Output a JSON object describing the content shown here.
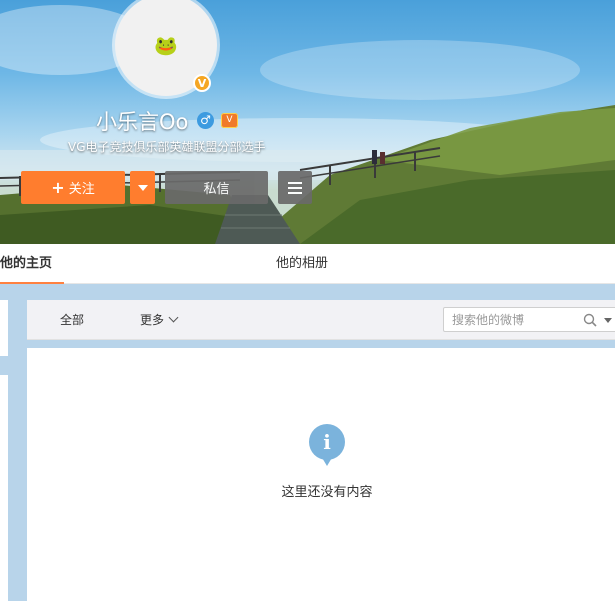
{
  "profile": {
    "avatar_emoji": "🐸",
    "verified_glyph": "V",
    "name": "小乐言Oo",
    "gender_glyph": "♂",
    "member_glyph": "V",
    "bio": "VG电子竞技俱乐部英雄联盟分部选手"
  },
  "actions": {
    "follow_plus": "+",
    "follow_label": "关注",
    "message_label": "私信"
  },
  "tabs": [
    {
      "label": "他的主页",
      "active": true
    },
    {
      "label": "他的相册",
      "active": false
    }
  ],
  "feed": {
    "filters": {
      "all": "全部",
      "more": "更多"
    },
    "search_placeholder": "搜索他的微博",
    "empty_icon": "i",
    "empty_message": "这里还没有内容"
  },
  "colors": {
    "accent": "#ff7d2e",
    "tab_underline": "#ff8140",
    "info_icon": "#7bb3dc",
    "page_background": "#b8d4ea"
  }
}
